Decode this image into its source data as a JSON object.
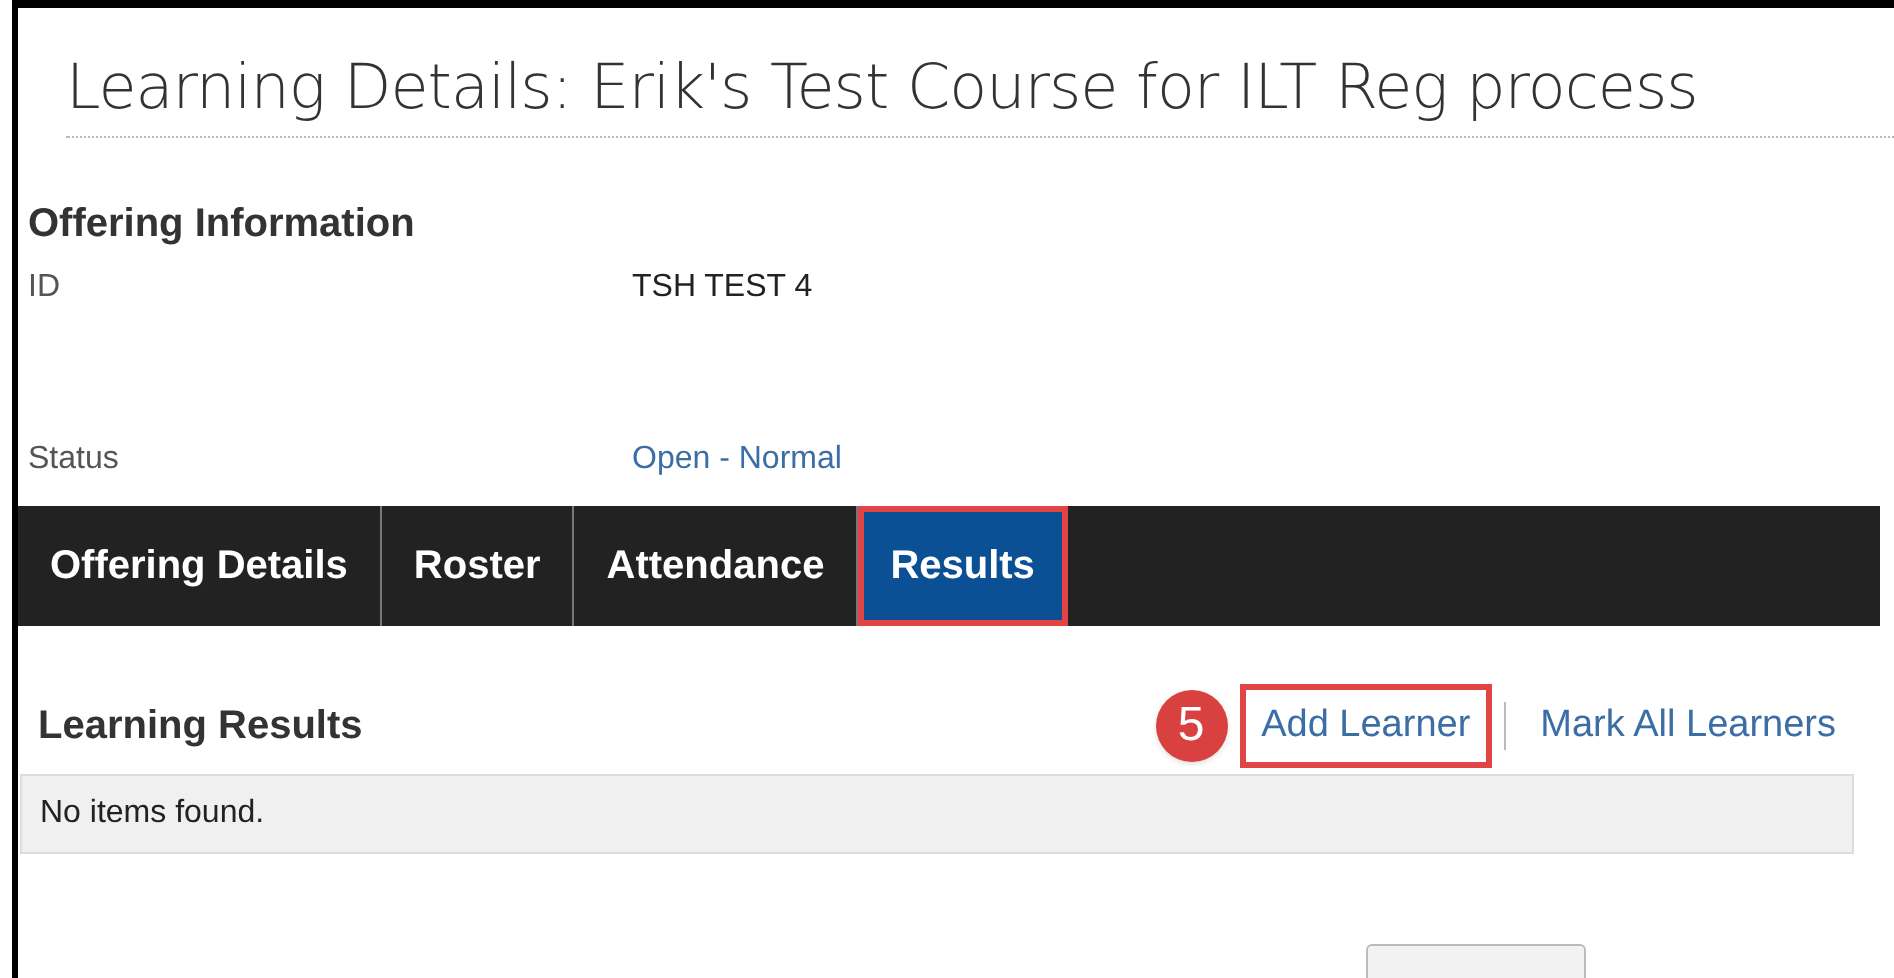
{
  "title": "Learning Details: Erik's Test Course for ILT Reg process",
  "offering": {
    "heading": "Offering Information",
    "fields": [
      {
        "label": "ID",
        "value": "TSH TEST 4",
        "kind": "text"
      },
      {
        "label": "Status",
        "value": "Open - Normal",
        "kind": "link"
      }
    ]
  },
  "tabs": [
    {
      "label": "Offering Details",
      "selected": false,
      "highlighted": false
    },
    {
      "label": "Roster",
      "selected": false,
      "highlighted": false
    },
    {
      "label": "Attendance",
      "selected": false,
      "highlighted": false
    },
    {
      "label": "Results",
      "selected": true,
      "highlighted": true
    }
  ],
  "results": {
    "heading": "Learning Results",
    "callout": "5",
    "actions": [
      {
        "label": "Add Learner",
        "highlighted": true
      },
      {
        "label": "Mark All Learners",
        "highlighted": false
      }
    ],
    "empty_message": "No items found."
  }
}
